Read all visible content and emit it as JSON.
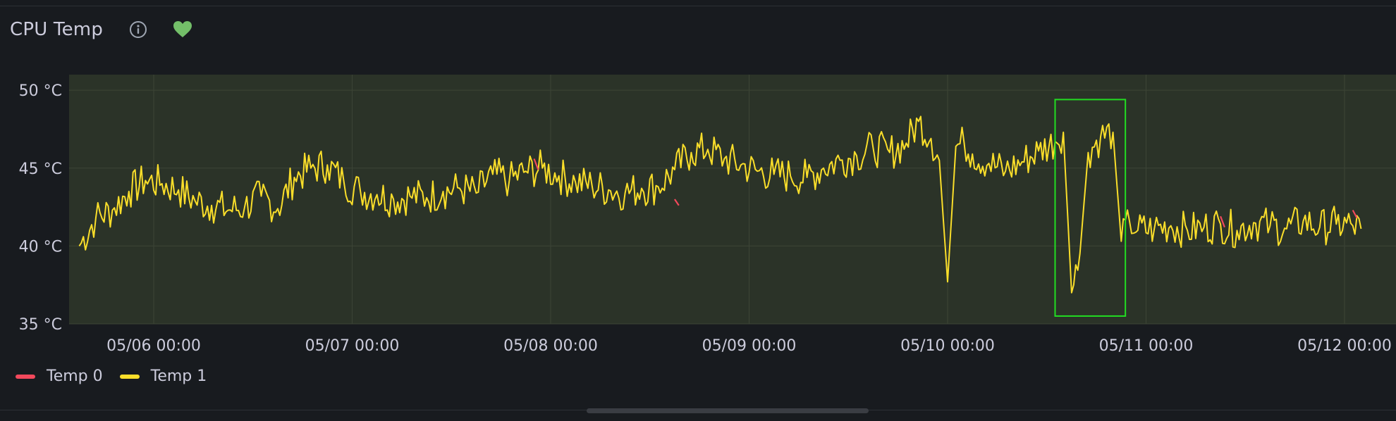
{
  "panel": {
    "title": "CPU Temp",
    "icons": {
      "info": "info-circle-icon",
      "health": "heart-icon"
    },
    "health_color": "#73bf69"
  },
  "legend": [
    {
      "name": "Temp 0",
      "color": "#f2495c"
    },
    {
      "name": "Temp 1",
      "color": "#fade2a"
    }
  ],
  "chart_data": {
    "type": "line",
    "title": "CPU Temp",
    "xlabel": "",
    "ylabel": "",
    "x_range": [
      "05/05 15:00",
      "05/12 02:00"
    ],
    "x_ticks": [
      "05/06 00:00",
      "05/07 00:00",
      "05/08 00:00",
      "05/09 00:00",
      "05/10 00:00",
      "05/11 00:00",
      "05/12 00:00"
    ],
    "ylim": [
      35,
      51
    ],
    "y_ticks": [
      35,
      40,
      45,
      50
    ],
    "y_tick_labels": [
      "35 °C",
      "40 °C",
      "45 °C",
      "50 °C"
    ],
    "grid": true,
    "legend_position": "bottom-left",
    "background_color": "#2b3328",
    "series": [
      {
        "name": "Temp 1",
        "color": "#fade2a",
        "points": [
          [
            "05/05 15:00",
            40.0
          ],
          [
            "05/05 17:00",
            41.8
          ],
          [
            "05/05 19:00",
            42.3
          ],
          [
            "05/05 21:00",
            43.5
          ],
          [
            "05/05 23:00",
            44.2
          ],
          [
            "05/06 01:00",
            44.0
          ],
          [
            "05/06 03:00",
            43.6
          ],
          [
            "05/06 05:00",
            42.9
          ],
          [
            "05/06 07:00",
            42.6
          ],
          [
            "05/06 09:00",
            42.3
          ],
          [
            "05/06 11:00",
            42.5
          ],
          [
            "05/06 13:00",
            43.2
          ],
          [
            "05/06 15:00",
            42.4
          ],
          [
            "05/06 17:00",
            44.4
          ],
          [
            "05/06 19:00",
            45.0
          ],
          [
            "05/06 21:00",
            45.2
          ],
          [
            "05/06 23:00",
            44.1
          ],
          [
            "05/07 01:00",
            43.5
          ],
          [
            "05/07 03:00",
            43.3
          ],
          [
            "05/07 05:00",
            43.0
          ],
          [
            "05/07 07:00",
            43.2
          ],
          [
            "05/07 09:00",
            43.1
          ],
          [
            "05/07 11:00",
            43.5
          ],
          [
            "05/07 13:00",
            43.7
          ],
          [
            "05/07 15:00",
            43.4
          ],
          [
            "05/07 17:00",
            44.6
          ],
          [
            "05/07 19:00",
            44.2
          ],
          [
            "05/07 21:00",
            44.8
          ],
          [
            "05/07 23:00",
            45.0
          ],
          [
            "05/08 01:00",
            44.5
          ],
          [
            "05/08 03:00",
            44.1
          ],
          [
            "05/08 05:00",
            43.9
          ],
          [
            "05/08 07:00",
            43.6
          ],
          [
            "05/08 09:00",
            43.4
          ],
          [
            "05/08 11:00",
            43.7
          ],
          [
            "05/08 13:00",
            43.8
          ],
          [
            "05/08 15:00",
            44.9
          ],
          [
            "05/08 17:00",
            46.0
          ],
          [
            "05/08 19:00",
            46.2
          ],
          [
            "05/08 21:00",
            45.6
          ],
          [
            "05/08 23:00",
            45.2
          ],
          [
            "05/09 01:00",
            44.8
          ],
          [
            "05/09 03:00",
            44.6
          ],
          [
            "05/09 05:00",
            44.5
          ],
          [
            "05/09 07:00",
            44.4
          ],
          [
            "05/09 09:00",
            45.0
          ],
          [
            "05/09 11:00",
            45.5
          ],
          [
            "05/09 13:00",
            45.8
          ],
          [
            "05/09 15:00",
            46.3
          ],
          [
            "05/09 17:00",
            46.0
          ],
          [
            "05/09 19:00",
            46.6
          ],
          [
            "05/09 20:30",
            48.0
          ],
          [
            "05/09 22:00",
            46.9
          ],
          [
            "05/09 23:00",
            45.5
          ],
          [
            "05/10 00:00",
            37.7
          ],
          [
            "05/10 01:00",
            46.4
          ],
          [
            "05/10 02:00",
            46.6
          ],
          [
            "05/10 03:00",
            45.9
          ],
          [
            "05/10 05:00",
            45.3
          ],
          [
            "05/10 07:00",
            44.8
          ],
          [
            "05/10 09:00",
            45.4
          ],
          [
            "05/10 11:00",
            46.1
          ],
          [
            "05/10 13:00",
            46.7
          ],
          [
            "05/10 14:00",
            47.3
          ],
          [
            "05/10 15:00",
            37.0
          ],
          [
            "05/10 16:00",
            39.5
          ],
          [
            "05/10 17:00",
            46.0
          ],
          [
            "05/10 18:30",
            47.0
          ],
          [
            "05/10 20:00",
            47.3
          ],
          [
            "05/10 21:00",
            40.3
          ],
          [
            "05/10 22:00",
            41.6
          ],
          [
            "05/10 23:00",
            41.0
          ],
          [
            "05/11 01:00",
            41.1
          ],
          [
            "05/11 03:00",
            41.3
          ],
          [
            "05/11 05:00",
            41.0
          ],
          [
            "05/11 07:00",
            41.2
          ],
          [
            "05/11 09:00",
            41.4
          ],
          [
            "05/11 11:00",
            41.0
          ],
          [
            "05/11 13:00",
            41.5
          ],
          [
            "05/11 15:00",
            41.3
          ],
          [
            "05/11 17:00",
            41.1
          ],
          [
            "05/11 19:00",
            41.6
          ],
          [
            "05/11 21:00",
            41.2
          ],
          [
            "05/11 23:00",
            41.4
          ],
          [
            "05/12 01:00",
            41.3
          ],
          [
            "05/12 02:00",
            41.1
          ]
        ]
      },
      {
        "name": "Temp 0",
        "color": "#f2495c",
        "points": [
          [
            "05/07 22:00",
            45.6
          ],
          [
            "05/07 22:30",
            44.9
          ],
          [
            "05/08 15:00",
            43.0
          ],
          [
            "05/08 15:30",
            42.6
          ],
          [
            "05/11 09:00",
            41.9
          ],
          [
            "05/11 09:30",
            41.2
          ],
          [
            "05/12 01:00",
            42.3
          ],
          [
            "05/12 01:30",
            41.8
          ]
        ]
      }
    ],
    "annotations": [
      {
        "type": "highlight-box",
        "color": "#22dd22",
        "x_from": "05/10 13:00",
        "x_to": "05/10 21:30",
        "y_from": 35.5,
        "y_to": 49.4
      }
    ]
  }
}
